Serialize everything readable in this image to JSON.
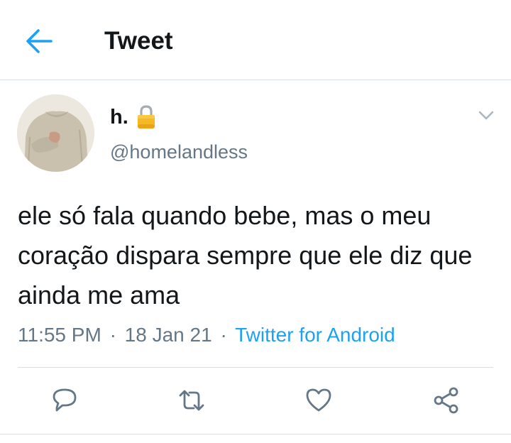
{
  "header": {
    "title": "Tweet",
    "back_icon": "arrow-left-icon"
  },
  "author": {
    "display_name": "h.",
    "handle": "@homelandless",
    "protected_icon": "lock-icon",
    "avatar": "profile-photo"
  },
  "tweet": {
    "text": "ele só fala quando bebe, mas o meu coração dispara sempre que ele diz que ainda me ama",
    "time": "11:55 PM",
    "separator": "·",
    "date": "18 Jan 21",
    "source": "Twitter for Android"
  },
  "actions": {
    "reply_icon": "reply-icon",
    "retweet_icon": "retweet-icon",
    "like_icon": "heart-icon",
    "share_icon": "share-icon"
  },
  "colors": {
    "accent": "#1da1f2",
    "text": "#14171a",
    "secondary": "#657786",
    "divider": "#d9dee2"
  }
}
